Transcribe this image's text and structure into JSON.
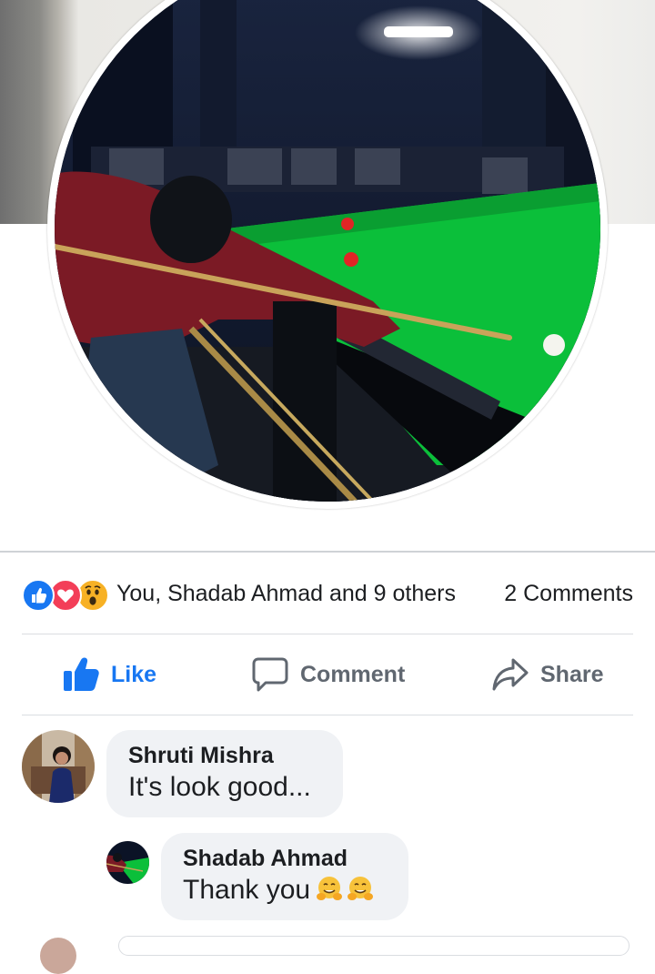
{
  "post": {
    "reactions": {
      "icons": [
        "like-reaction-icon",
        "love-reaction-icon",
        "wow-reaction-icon"
      ],
      "summary": "You, Shadab Ahmad and 9 others",
      "comments_count": "2 Comments"
    },
    "actions": {
      "like": "Like",
      "comment": "Comment",
      "share": "Share"
    }
  },
  "comments": [
    {
      "author": "Shruti Mishra",
      "text": "It's look good..."
    }
  ],
  "replies": [
    {
      "author": "Shadab Ahmad",
      "text": "Thank you",
      "emojis": [
        "hugging-face-emoji",
        "hugging-face-emoji"
      ]
    }
  ],
  "colors": {
    "like_blue": "#1877f2",
    "love_red": "#f33e58",
    "wow_yellow": "#f7b125",
    "bubble_bg": "#f0f2f5",
    "secondary_text": "#606770",
    "table_green": "#0bbf3a"
  }
}
